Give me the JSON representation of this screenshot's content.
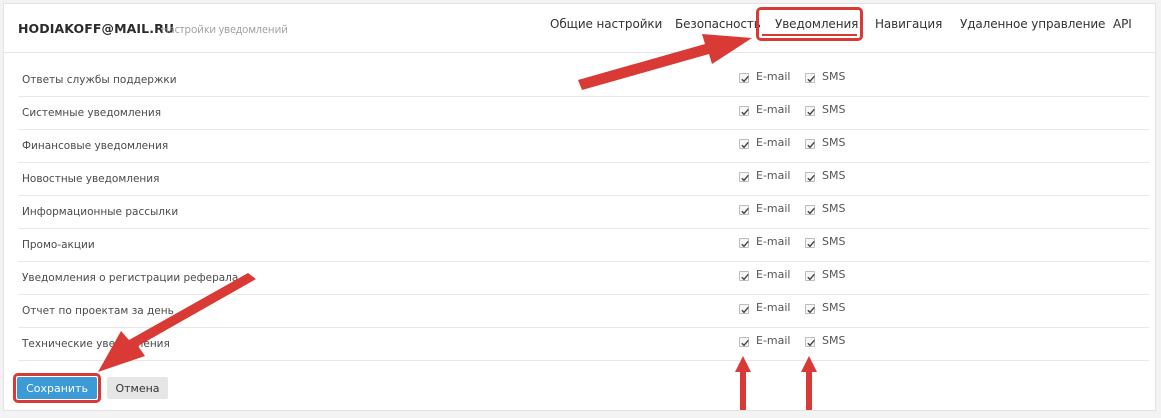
{
  "header": {
    "account": "HODIAKOFF@MAIL.RU",
    "subtitle": "Настройки уведомлений"
  },
  "tabs": [
    {
      "label": "Общие настройки",
      "active": false
    },
    {
      "label": "Безопасность",
      "active": false
    },
    {
      "label": "Уведомления",
      "active": true
    },
    {
      "label": "Навигация",
      "active": false
    },
    {
      "label": "Удаленное управление",
      "active": false
    },
    {
      "label": "API",
      "active": false
    }
  ],
  "channels": {
    "email": "E-mail",
    "sms": "SMS"
  },
  "rows": [
    {
      "label": "Ответы службы поддержки",
      "email": true,
      "sms": true
    },
    {
      "label": "Системные уведомления",
      "email": true,
      "sms": true
    },
    {
      "label": "Финансовые уведомления",
      "email": true,
      "sms": true
    },
    {
      "label": "Новостные уведомления",
      "email": true,
      "sms": true
    },
    {
      "label": "Информационные рассылки",
      "email": true,
      "sms": true
    },
    {
      "label": "Промо-акции",
      "email": true,
      "sms": true
    },
    {
      "label": "Уведомления о регистрации реферала",
      "email": true,
      "sms": true
    },
    {
      "label": "Отчет по проектам за день",
      "email": true,
      "sms": true
    },
    {
      "label": "Технические уведомления",
      "email": true,
      "sms": true
    }
  ],
  "buttons": {
    "save": "Сохранить",
    "cancel": "Отмена"
  },
  "colors": {
    "accent": "#3c9ad6",
    "annotation": "#d93a35"
  }
}
